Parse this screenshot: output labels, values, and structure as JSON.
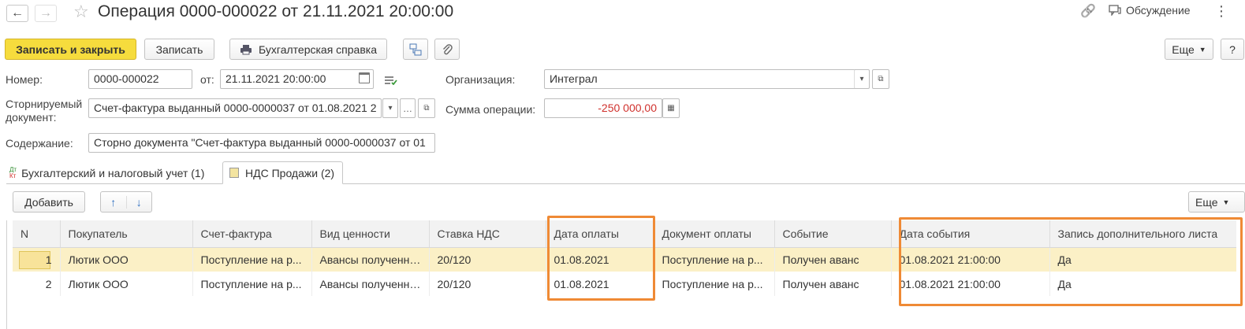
{
  "header": {
    "back_glyph": "←",
    "forward_glyph": "→",
    "star_glyph": "☆",
    "title": "Операция 0000-000022 от 21.11.2021 20:00:00",
    "link_glyph": "🔗",
    "discussion_label": "Обсуждение",
    "more_glyph": "⋮"
  },
  "toolbar": {
    "save_close": "Записать и закрыть",
    "save": "Записать",
    "accounting_ref": "Бухгалтерская справка",
    "more": "Еще",
    "help": "?"
  },
  "form": {
    "number_label": "Номер:",
    "number_value": "0000-000022",
    "from_label": "от:",
    "date_value": "21.11.2021 20:00:00",
    "org_label": "Организация:",
    "org_value": "Интеграл",
    "storno_label_1": "Сторнируемый",
    "storno_label_2": "документ:",
    "storno_value": "Счет-фактура выданный 0000-0000037 от 01.08.2021 2",
    "sum_label": "Сумма операции:",
    "sum_value": "-250 000,00",
    "content_label": "Содержание:",
    "content_value": "Сторно документа \"Счет-фактура выданный 0000-0000037 от 01"
  },
  "tabs": [
    {
      "icon": "Дт Кт",
      "label": "Бухгалтерский и налоговый учет (1)"
    },
    {
      "icon": "✎",
      "label": "НДС Продажи (2)"
    }
  ],
  "table_toolbar": {
    "add": "Добавить",
    "up": "↑",
    "down": "↓",
    "more": "Еще"
  },
  "table": {
    "columns": [
      "N",
      "Покупатель",
      "Счет-фактура",
      "Вид ценности",
      "Ставка НДС",
      "Дата оплаты",
      "Документ оплаты",
      "Событие",
      "Дата события",
      "Запись дополнительного листа"
    ],
    "rows": [
      [
        "1",
        "Лютик ООО",
        "Поступление на р...",
        "Авансы полученные",
        "20/120",
        "01.08.2021",
        "Поступление на р...",
        "Получен аванс",
        "01.08.2021 21:00:00",
        "Да"
      ],
      [
        "2",
        "Лютик ООО",
        "Поступление на р...",
        "Авансы полученные",
        "20/120",
        "01.08.2021",
        "Поступление на р...",
        "Получен аванс",
        "01.08.2021 21:00:00",
        "Да"
      ]
    ]
  },
  "colors": {
    "primary_button": "#f6dc3d",
    "highlight_frame": "#ef8a35",
    "negative_sum": "#d0312d",
    "selected_row": "#fbf0c6"
  }
}
